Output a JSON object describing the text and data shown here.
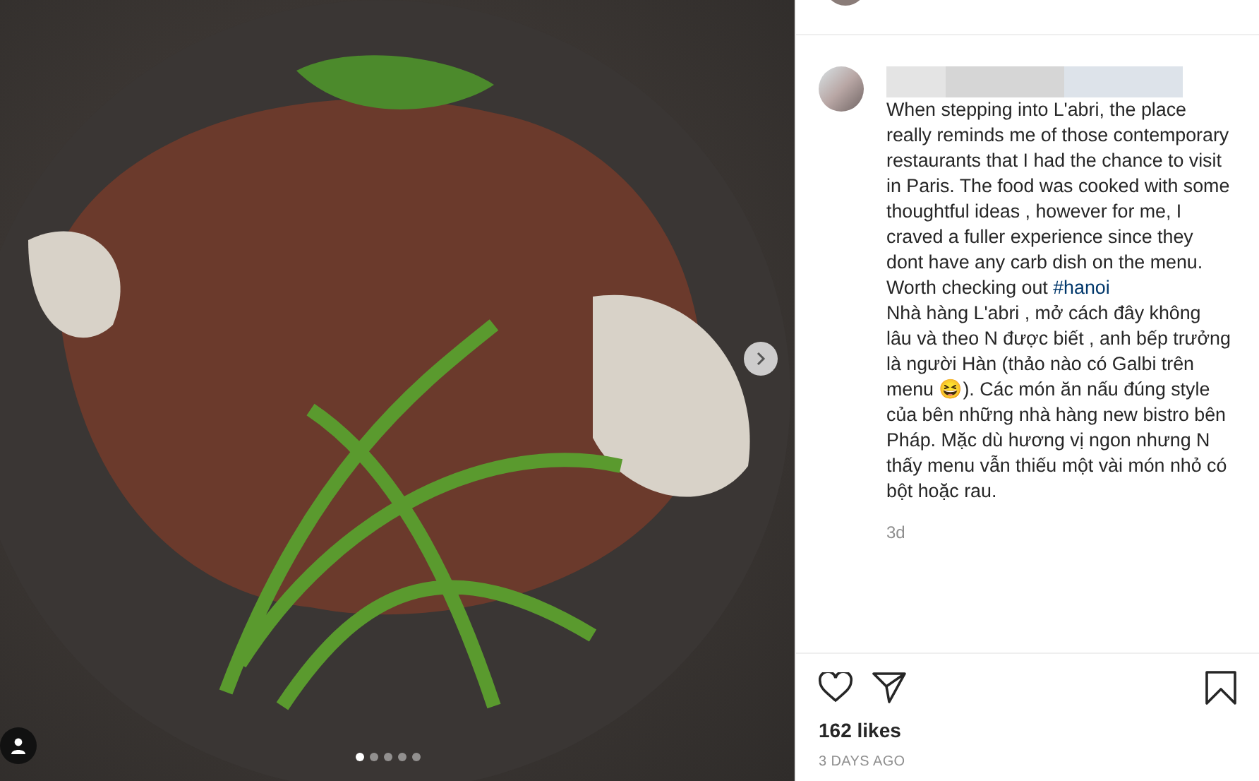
{
  "photo": {
    "slides": [
      {
        "selected": true
      },
      {
        "selected": false
      },
      {
        "selected": false
      },
      {
        "selected": false
      },
      {
        "selected": false
      }
    ]
  },
  "caption": {
    "text": "When stepping into L'abri, the place really reminds me of those contemporary restaurants that I had the chance to visit in Paris. The food was cooked with some thoughtful ideas , however for me, I craved a fuller experience since they dont have any carb dish on the menu. Worth checking out ",
    "hashtag": "#hanoi",
    "text_vi": "Nhà hàng L'abri , mở cách đây không lâu và theo N được biết , anh bếp trưởng là người Hàn (thảo nào có Galbi trên menu 😆). Các món ăn nấu đúng style của bên những nhà hàng new bistro bên Pháp. Mặc dù hương vị ngon nhưng N thấy menu vẫn thiếu một vài món nhỏ có bột hoặc rau.",
    "age": "3d"
  },
  "likes": "162 likes",
  "posted": "3 DAYS AGO"
}
